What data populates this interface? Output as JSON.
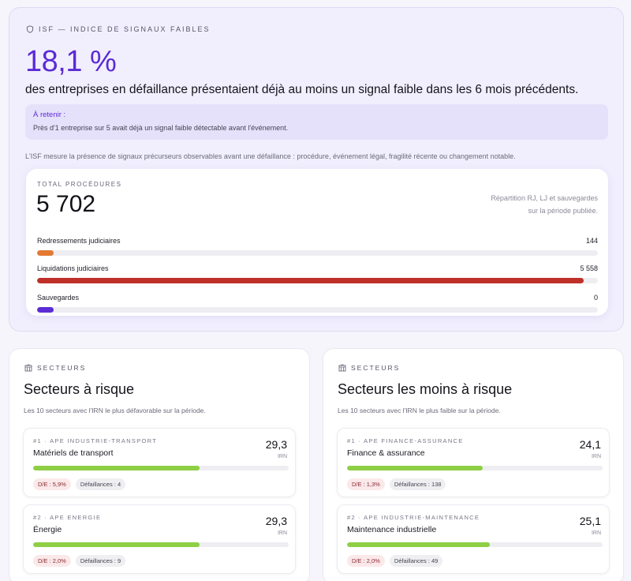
{
  "colors": {
    "accent": "#5b2bd6",
    "redressement": "#e27a33",
    "liquidation": "#c0302a",
    "sauvegarde": "#5b2bd6",
    "irn_bar": "#8fcf45"
  },
  "isf": {
    "eyebrow": "ISF — INDICE DE SIGNAUX FAIBLES",
    "value": "18,1 %",
    "description": "des entreprises en défaillance présentaient déjà au moins un signal faible dans les 6 mois précédents.",
    "retain_title": "À retenir :",
    "retain_text": "Près d'1 entreprise sur 5 avait déjà un signal faible détectable avant l'événement.",
    "note": "L'ISF mesure la présence de signaux précurseurs observables avant une défaillance : procédure, événement légal, fragilité récente ou changement notable."
  },
  "procedures": {
    "eyebrow": "TOTAL PROCÉDURES",
    "total": "5 702",
    "side_line1": "Répartition RJ, LJ et sauvegardes",
    "side_line2": "sur la période publiée.",
    "rows": [
      {
        "label": "Redressements judiciaires",
        "value": "144",
        "fill": 0.03
      },
      {
        "label": "Liquidations judiciaires",
        "value": "5 558",
        "fill": 0.975
      },
      {
        "label": "Sauvegardes",
        "value": "0",
        "fill": 0.03
      }
    ]
  },
  "risk": {
    "eyebrow": "SECTEURS",
    "title": "Secteurs à risque",
    "subtitle": "Les 10 secteurs avec l'IRN le plus défavorable sur la période.",
    "items": [
      {
        "code": "#1 · APE INDUSTRIE-TRANSPORT",
        "name": "Matériels de transport",
        "irn": "29,3",
        "irn_label": "IRN",
        "fill": 0.65,
        "de": "D/E : 5,9%",
        "def": "Défaillances : 4"
      },
      {
        "code": "#2 · APE ENERGIE",
        "name": "Énergie",
        "irn": "29,3",
        "irn_label": "IRN",
        "fill": 0.65,
        "de": "D/E : 2,0%",
        "def": "Défaillances : 9"
      }
    ]
  },
  "safe": {
    "eyebrow": "SECTEURS",
    "title": "Secteurs les moins à risque",
    "subtitle": "Les 10 secteurs avec l'IRN le plus faible sur la période.",
    "items": [
      {
        "code": "#1 · APE FINANCE-ASSURANCE",
        "name": "Finance & assurance",
        "irn": "24,1",
        "irn_label": "IRN",
        "fill": 0.53,
        "de": "D/E : 1,3%",
        "def": "Défaillances : 138"
      },
      {
        "code": "#2 · APE INDUSTRIE-MAINTENANCE",
        "name": "Maintenance industrielle",
        "irn": "25,1",
        "irn_label": "IRN",
        "fill": 0.56,
        "de": "D/E : 2,0%",
        "def": "Défaillances : 49"
      }
    ]
  }
}
